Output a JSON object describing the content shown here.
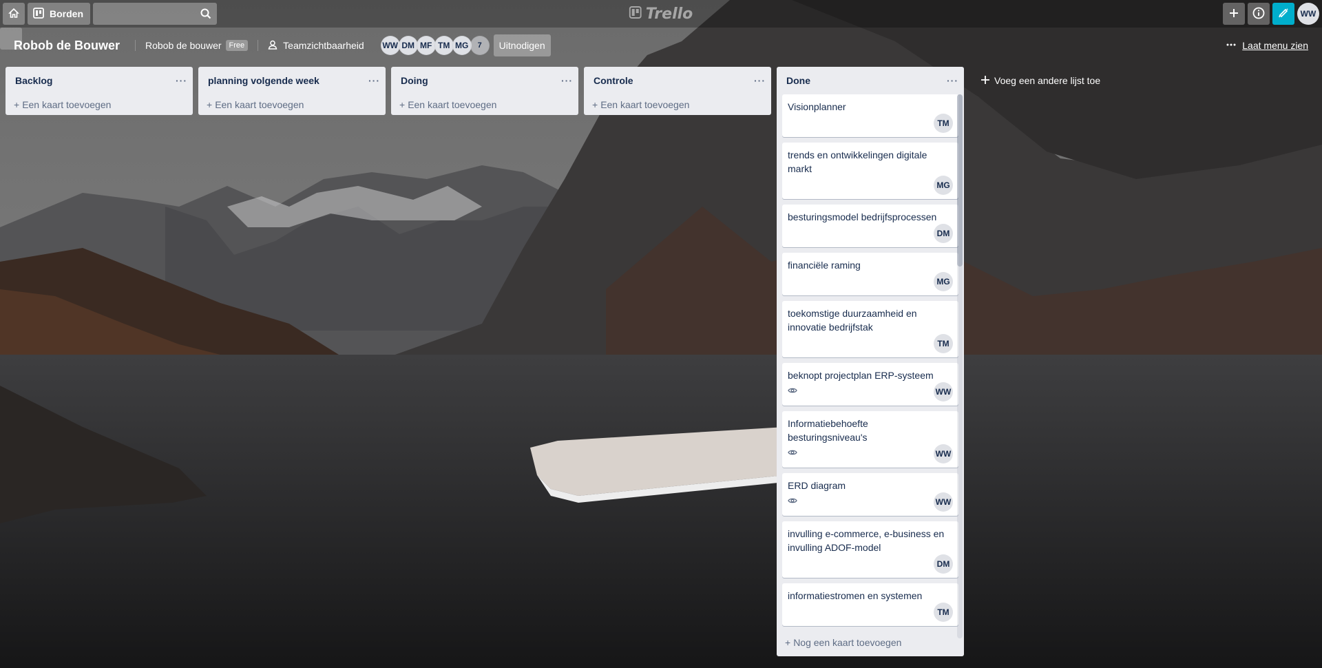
{
  "header": {
    "home_icon": "home-icon",
    "boards_label": "Borden",
    "search_placeholder": "",
    "logo_text": "Trello",
    "user_initials": "WW"
  },
  "board": {
    "title": "Robob de Bouwer",
    "workspace": "Robob de bouwer",
    "workspace_badge": "Free",
    "visibility": "Teamzichtbaarheid",
    "members": [
      "WW",
      "DM",
      "MF",
      "TM",
      "MG"
    ],
    "extra_members": "7",
    "invite_label": "Uitnodigen",
    "menu_label": "Laat menu zien"
  },
  "lists": [
    {
      "title": "Backlog",
      "add_label": "Een kaart toevoegen"
    },
    {
      "title": "planning volgende week",
      "add_label": "Een kaart toevoegen"
    },
    {
      "title": "Doing",
      "add_label": "Een kaart toevoegen"
    },
    {
      "title": "Controle",
      "add_label": "Een kaart toevoegen"
    }
  ],
  "done_list": {
    "title": "Done",
    "add_label": "Nog een kaart toevoegen",
    "cards": [
      {
        "title": "Visionplanner",
        "member": "TM",
        "watch": false
      },
      {
        "title": "trends en ontwikkelingen digitale markt",
        "member": "MG",
        "watch": false
      },
      {
        "title": "besturingsmodel bedrijfsprocessen",
        "member": "DM",
        "watch": false
      },
      {
        "title": "financiële raming",
        "member": "MG",
        "watch": false
      },
      {
        "title": "toekomstige duurzaamheid en innovatie bedrijfstak",
        "member": "TM",
        "watch": false
      },
      {
        "title": "beknopt projectplan ERP-systeem",
        "member": "WW",
        "watch": true
      },
      {
        "title": "Informatiebehoefte besturingsniveau's",
        "member": "WW",
        "watch": true
      },
      {
        "title": "ERD diagram",
        "member": "WW",
        "watch": true
      },
      {
        "title": "invulling e-commerce, e-business en invulling ADOF-model",
        "member": "DM",
        "watch": false
      },
      {
        "title": "informatiestromen en systemen",
        "member": "TM",
        "watch": false
      }
    ]
  },
  "add_list_label": "Voeg een andere lijst toe",
  "colors": {
    "notify": "#00aecc",
    "list_bg": "#ebecf0",
    "text": "#172b4d",
    "star": "#f2d600"
  }
}
